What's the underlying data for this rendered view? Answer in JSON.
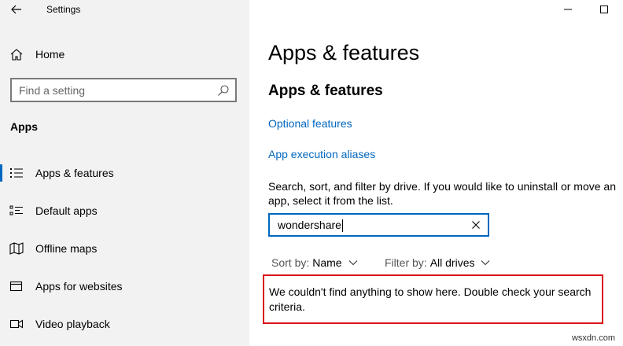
{
  "window": {
    "title": "Settings"
  },
  "sidebar": {
    "home_label": "Home",
    "search_placeholder": "Find a setting",
    "section_heading": "Apps",
    "items": [
      {
        "label": "Apps & features",
        "icon": "apps-features-icon",
        "active": true
      },
      {
        "label": "Default apps",
        "icon": "default-apps-icon",
        "active": false
      },
      {
        "label": "Offline maps",
        "icon": "offline-maps-icon",
        "active": false
      },
      {
        "label": "Apps for websites",
        "icon": "apps-websites-icon",
        "active": false
      },
      {
        "label": "Video playback",
        "icon": "video-playback-icon",
        "active": false
      }
    ]
  },
  "main": {
    "page_title": "Apps & features",
    "sub_title": "Apps & features",
    "links": [
      {
        "label": "Optional features"
      },
      {
        "label": "App execution aliases"
      }
    ],
    "description": "Search, sort, and filter by drive. If you would like to uninstall or move an app, select it from the list.",
    "search_value": "wondershare",
    "sort": {
      "label": "Sort by:",
      "value": "Name"
    },
    "filter": {
      "label": "Filter by:",
      "value": "All drives"
    },
    "empty_message": "We couldn't find anything to show here. Double check your search criteria."
  },
  "watermark": "wsxdn.com",
  "colors": {
    "accent": "#0067c0",
    "highlight_border": "#d9131a",
    "sidebar_bg": "#f2f2f2"
  }
}
